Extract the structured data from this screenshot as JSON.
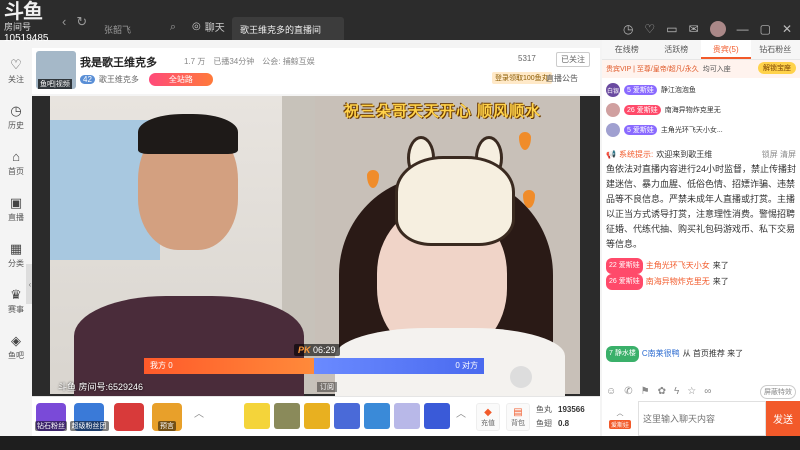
{
  "logo": {
    "title": "斗鱼",
    "subtitle": "房间号",
    "room_id": "10519485"
  },
  "search": {
    "value": "张韶飞"
  },
  "nav_tabs": {
    "chat": "聊天",
    "room_tab": "歌王维克多的直播间"
  },
  "left_nav": [
    {
      "icon": "heart-icon",
      "label": "关注"
    },
    {
      "icon": "clock-icon",
      "label": "历史"
    },
    {
      "icon": "home-icon",
      "label": "首页"
    },
    {
      "icon": "tv-icon",
      "label": "直播"
    },
    {
      "icon": "grid-icon",
      "label": "分类"
    },
    {
      "icon": "trophy-icon",
      "label": "赛事"
    },
    {
      "icon": "fish-icon",
      "label": "鱼吧"
    }
  ],
  "room": {
    "title": "我是歌王维克多",
    "heat": "1.7 万",
    "followers": "已播34分钟",
    "notice": "公会: 捕鲸互娱",
    "anchor_level": "42",
    "anchor_name": "歌王维克多",
    "fullsite": "全站路",
    "avatar_tag": "鱼吧|视频",
    "report_count": "5317",
    "follow_label": "已关注",
    "gift_level": "登录领取100鱼丸",
    "announcement": "直播公告"
  },
  "video": {
    "banner": "祝三朵哥天天开心 顺风顺水",
    "pk_label": "PK",
    "pk_time": "06:29",
    "pk_left": "我方 0",
    "pk_right": "0 对方",
    "watermark": "斗鱼 房间号:6529246",
    "cam_label": "订阅"
  },
  "bottom": {
    "items": [
      {
        "label": "钻石粉丝",
        "color": "#7a4ad8"
      },
      {
        "label": "超级粉丝团",
        "color": "#3a7ad8"
      },
      {
        "label": "",
        "color": "#d83a3a"
      },
      {
        "label": "预言",
        "color": "#e8a02a"
      }
    ],
    "gifts": [
      "#f4d43a",
      "#8a8a5a",
      "#e8b020",
      "#4a6ad8",
      "#3a8ad8",
      "#b8b8e8",
      "#3a5ad8"
    ],
    "recharge": "充值",
    "backpack": "背包",
    "yuchi_label": "鱼丸",
    "yuchi_value": "193566",
    "yuchi2_label": "鱼翅",
    "yuchi2_value": "0.8"
  },
  "right": {
    "tabs": [
      "在线榜",
      "活跃榜",
      "贵宾(5)",
      "钻石粉丝"
    ],
    "active_tab": 2,
    "noble_text": "贵宾VIP | 至尊/皇帝/超凡/永久",
    "noble_link": "均可入座",
    "unlock": "解锁宝座",
    "nobles": [
      {
        "medal": "白银",
        "badge": "5 爱斯娃",
        "name": "静江泡泡鱼",
        "medal_class": ""
      },
      {
        "medal": "",
        "badge": "26 爱斯娃",
        "name": "南海异物炸克里无",
        "medal_class": "red"
      },
      {
        "medal": "",
        "badge": "5 爱斯娃",
        "name": "主角光环飞天小女...",
        "medal_class": ""
      }
    ],
    "sys_label": "系统提示:",
    "sys_welcome": "欢迎来到歌王维",
    "sys_tools": "锁屏 清屏",
    "sys_body": "鱼依法对直播内容进行24小时监督，禁止传播封建迷信、暴力血腥、低俗色情、招嫖诈骗、违禁品等不良信息。严禁未成年人直播或打赏。主播以正当方式诱导打赏，注意理性消费。警惕招聘征婚、代练代抽、购买礼包码游戏币、私下交易等信息。",
    "chats": [
      {
        "badge": "22 爱斯娃",
        "user": "主角光环飞天小女",
        "text": "来了"
      },
      {
        "badge": "26 爱斯娃",
        "user": "南海异物炸克里无",
        "text": "来了"
      },
      {
        "badge": "7 静水楼",
        "user": "C南莱很鸭",
        "text": "从 首页推荐 来了"
      }
    ],
    "shield": "屏蔽特效",
    "fan_badge": "爱斯娃",
    "input_placeholder": "这里输入聊天内容",
    "send": "发送"
  }
}
